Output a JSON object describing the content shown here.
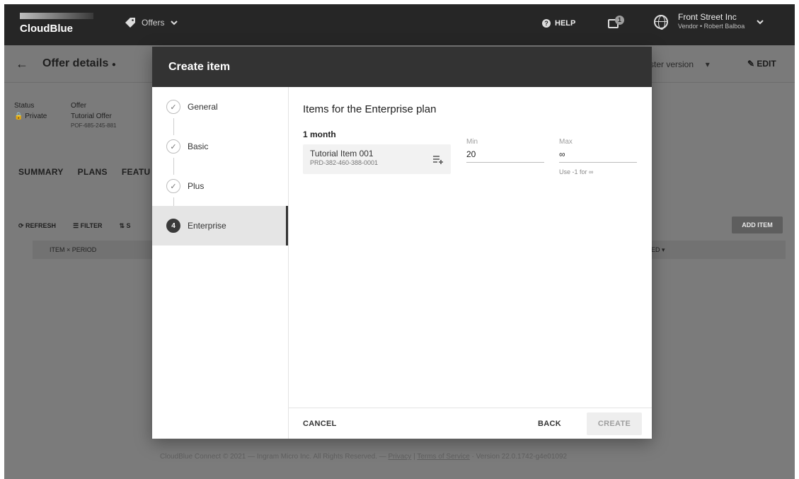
{
  "topbar": {
    "logo": "CloudBlue",
    "module": "Offers",
    "help": "HELP",
    "notifications_count": "1",
    "account_name": "Front Street Inc",
    "account_sub": "Vendor • Robert Balboa"
  },
  "page": {
    "title": "Offer details",
    "version_select": "ster version",
    "edit_label": "EDIT",
    "status_label": "Status",
    "status_value": "Private",
    "offer_label": "Offer",
    "offer_name": "Tutorial Offer",
    "offer_id": "POF-685-245-881",
    "tabs": [
      "SUMMARY",
      "PLANS",
      "FEATU"
    ],
    "toolbar": {
      "refresh": "REFRESH",
      "filter": "FILTER",
      "s": "S"
    },
    "add_item": "ADD ITEM",
    "table_col_1": "ITEM × PERIOD",
    "table_col_2": "ED ▾",
    "footer_prefix": "CloudBlue Connect © 2021 — Ingram Micro Inc. All Rights Reserved. — ",
    "footer_privacy": "Privacy",
    "footer_sep": " | ",
    "footer_terms": "Terms of Service",
    "footer_version": " · Version 22.0.1742-g4e01092"
  },
  "dialog": {
    "title": "Create item",
    "steps": [
      {
        "label": "General",
        "state": "done"
      },
      {
        "label": "Basic",
        "state": "done"
      },
      {
        "label": "Plus",
        "state": "done"
      },
      {
        "label": "Enterprise",
        "state": "active",
        "number": "4"
      }
    ],
    "content_title": "Items for the Enterprise plan",
    "period": "1 month",
    "item": {
      "name": "Tutorial Item 001",
      "id": "PRD-382-460-388-0001"
    },
    "min": {
      "label": "Min",
      "value": "20"
    },
    "max": {
      "label": "Max",
      "value": "∞",
      "help": "Use -1 for ∞"
    },
    "cancel": "CANCEL",
    "back": "BACK",
    "create": "CREATE"
  }
}
